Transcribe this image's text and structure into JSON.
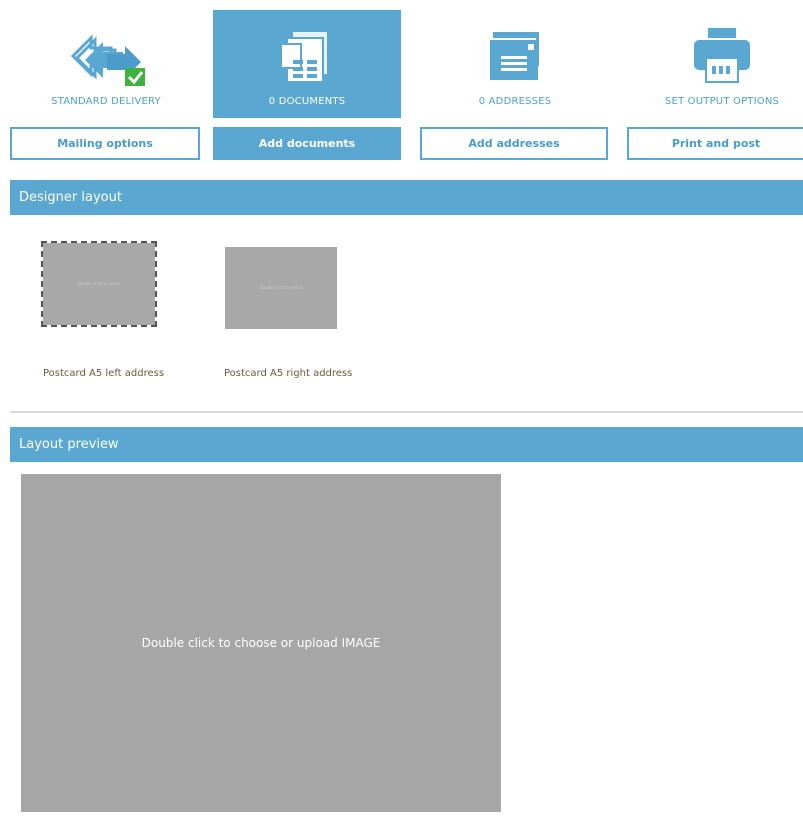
{
  "steps": [
    {
      "label": "STANDARD DELIVERY",
      "icon": "delivery-arrow-check-icon",
      "button": "Mailing options"
    },
    {
      "label": "0 DOCUMENTS",
      "icon": "documents-stack-icon",
      "button": "Add documents"
    },
    {
      "label": "0 ADDRESSES",
      "icon": "envelopes-stack-icon",
      "button": "Add addresses"
    },
    {
      "label": "SET OUTPUT OPTIONS",
      "icon": "printer-icon",
      "button": "Print and post"
    }
  ],
  "designer_layout": {
    "title": "Designer layout",
    "templates": [
      {
        "thumb_text": "Double click to select",
        "label": "Postcard A5 left address"
      },
      {
        "thumb_text": "Double click to select",
        "label": "Postcard A5 right address"
      }
    ]
  },
  "layout_preview": {
    "title": "Layout preview",
    "placeholder": "Double click to choose or upload IMAGE"
  },
  "colors": {
    "accent": "#5aa8d2",
    "placeholder_gray": "#a6a6a6",
    "check_green": "#3db33d"
  }
}
